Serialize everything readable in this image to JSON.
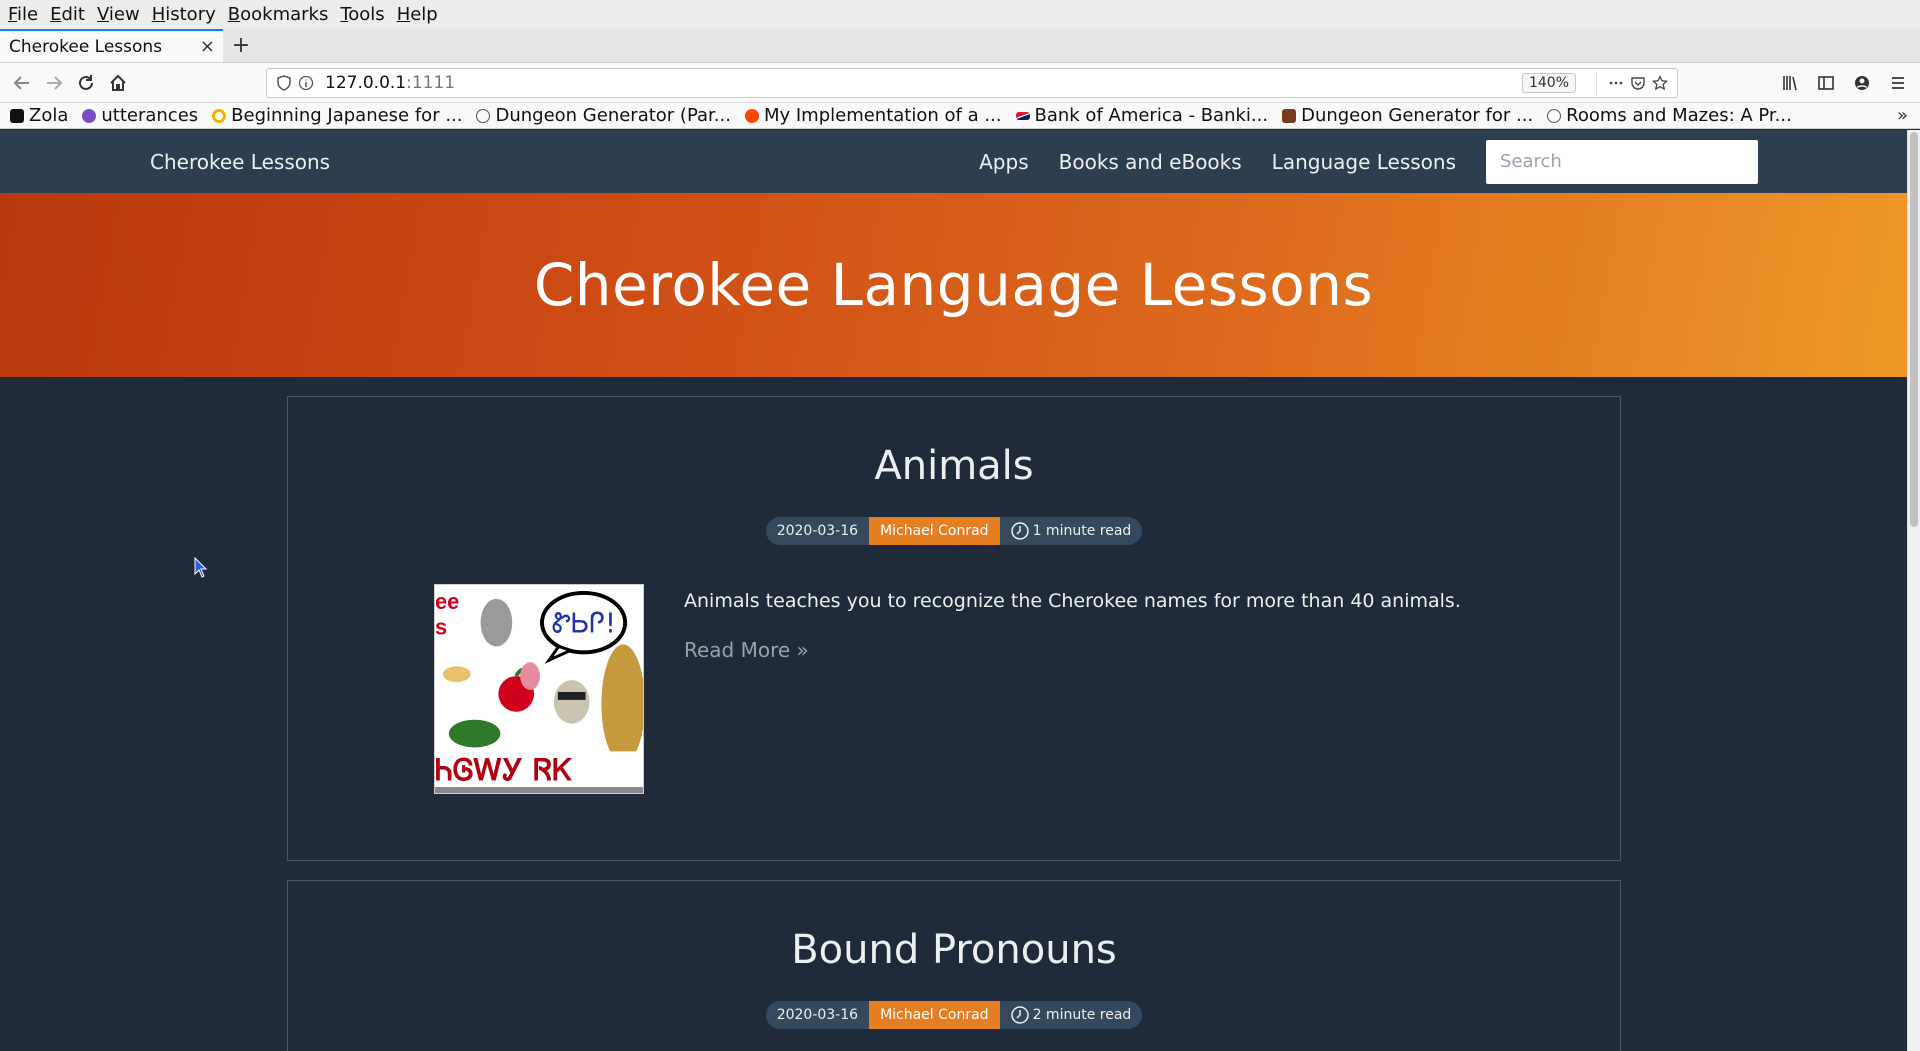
{
  "browser": {
    "menu": [
      "File",
      "Edit",
      "View",
      "History",
      "Bookmarks",
      "Tools",
      "Help"
    ],
    "tab_title": "Cherokee Lessons",
    "tab_close": "×",
    "new_tab": "+",
    "url_host": "127.0.0.1",
    "url_port": ":1111",
    "zoom": "140%",
    "bookmarks": [
      {
        "label": "Zola",
        "color": "#111111"
      },
      {
        "label": "utterances",
        "color": "#7b4fc4"
      },
      {
        "label": "Beginning Japanese for ...",
        "color": "#f0b400"
      },
      {
        "label": "Dungeon Generator (Par...",
        "color": "#555555"
      },
      {
        "label": "My Implementation of a ...",
        "color": "#ff4500"
      },
      {
        "label": "Bank of America - Banki...",
        "color": "#e31837"
      },
      {
        "label": "Dungeon Generator for ...",
        "color": "#7a3b1c"
      },
      {
        "label": "Rooms and Mazes: A Pr...",
        "color": "#555555"
      }
    ],
    "overflow": "»"
  },
  "site": {
    "brand": "Cherokee Lessons",
    "links": [
      "Apps",
      "Books and eBooks",
      "Language Lessons"
    ],
    "search_placeholder": "Search"
  },
  "hero": {
    "title": "Cherokee Language Lessons"
  },
  "posts": [
    {
      "title": "Animals",
      "date": "2020-03-16",
      "author": "Michael Conrad",
      "read_time": "1 minute read",
      "excerpt": "Animals teaches you to recognize the Cherokee names for more than 40 animals.",
      "read_more": "Read More »",
      "thumb_syllabary": "ᏂᎶᎳᎩ ᏒᏦ",
      "thumb_bubble": "ᏑᏏᎵ!"
    },
    {
      "title": "Bound Pronouns",
      "date": "2020-03-16",
      "author": "Michael Conrad",
      "read_time": "2 minute read"
    }
  ],
  "colors": {
    "page_bg": "#1f2b3a",
    "nav_bg": "#2c3e50",
    "accent": "#e67e22",
    "hero_start": "#b8390f",
    "hero_end": "#ee9828"
  }
}
